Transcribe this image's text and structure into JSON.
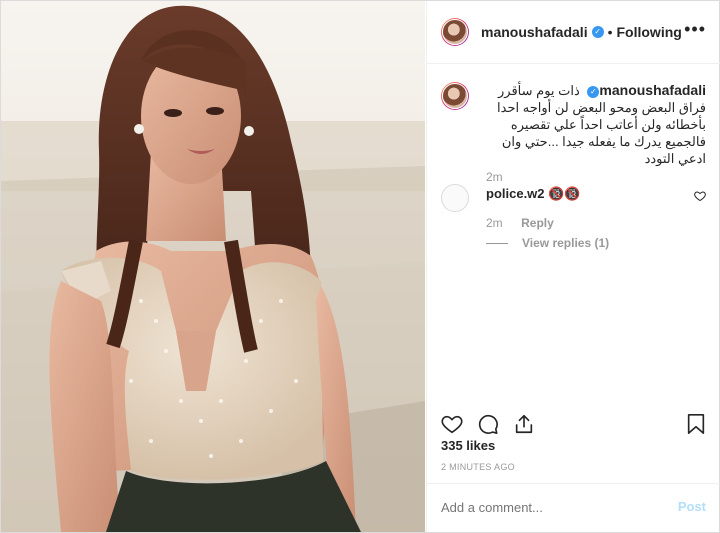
{
  "header": {
    "username": "manoushafadali",
    "separator": "•",
    "follow_label": "Following",
    "more_label": "•••"
  },
  "caption": {
    "username": "manoushafadali",
    "text": "ذات يوم سأقرر فراق البعض ومحو البعض لن أواجه احدا بأخطائه ولن أعاتب احداً علي تقصيره فالجميع يدرك ما يفعله جيدا ...حتي وان ادعي التودد",
    "time": "2m"
  },
  "comments": [
    {
      "username": "police.w2",
      "text": "🔞🔞",
      "time": "2m",
      "reply_label": "Reply",
      "view_replies_label": "View replies (1)"
    }
  ],
  "likes": "335 likes",
  "timestamp": "2 MINUTES AGO",
  "add_comment": {
    "placeholder": "Add a comment...",
    "post_label": "Post"
  },
  "colors": {
    "verified": "#3897f0",
    "post_button": "#b2dffc",
    "border": "#dbdbdb"
  },
  "icons": [
    "heart-icon",
    "comment-icon",
    "share-icon",
    "bookmark-icon",
    "verified-icon",
    "more-options-icon",
    "comment-like-heart-icon"
  ]
}
